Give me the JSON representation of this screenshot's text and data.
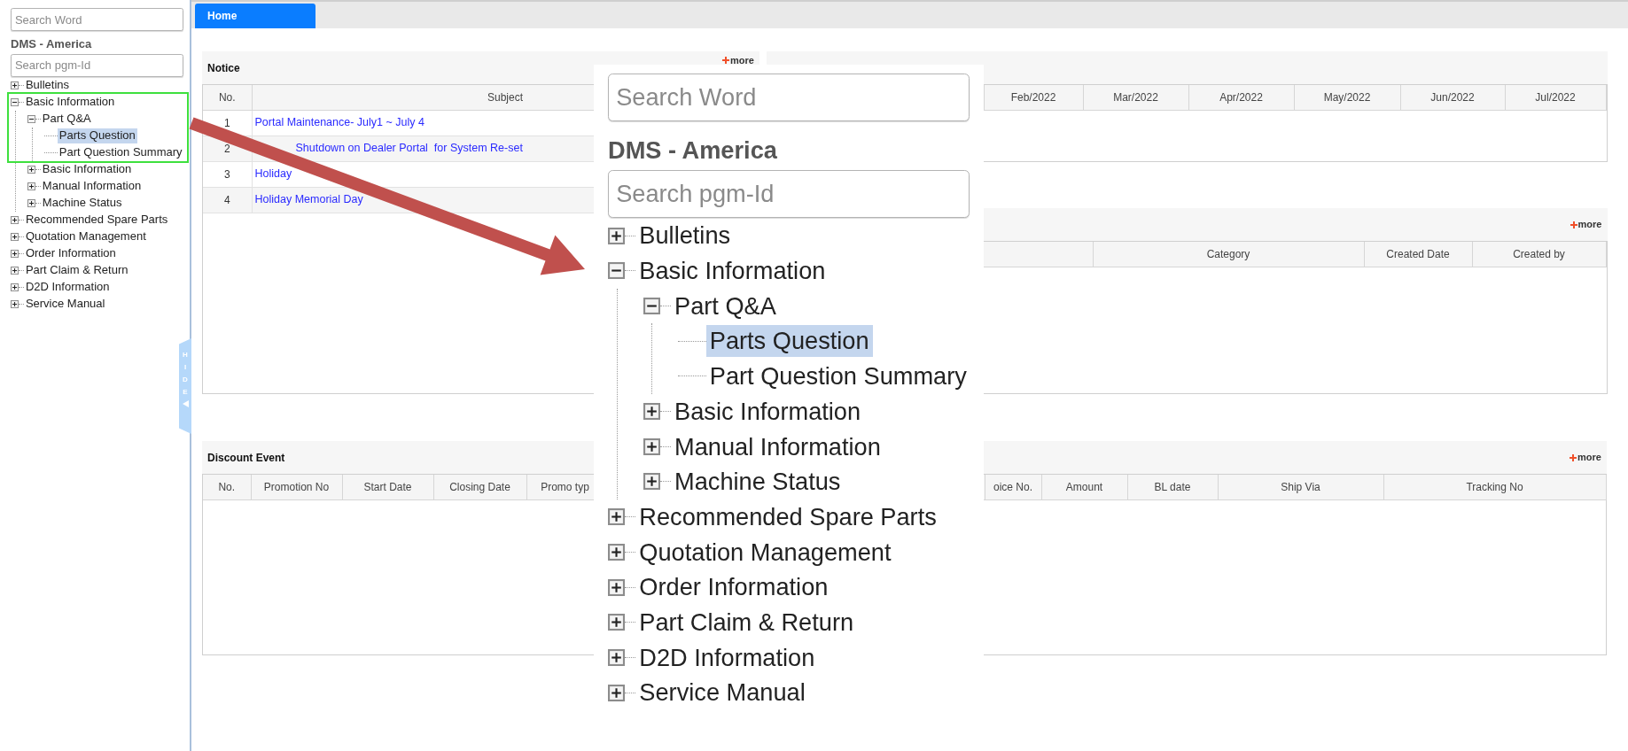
{
  "sidebar": {
    "search": {
      "placeholder": "Search Word"
    },
    "title": "DMS - America",
    "program_search": {
      "placeholder": "Search pgm-Id"
    },
    "tree": [
      {
        "label": "Bulletins",
        "expanded": false,
        "selected": false
      },
      {
        "label": "Basic Information",
        "expanded": true,
        "selected": false,
        "children": [
          {
            "label": "Part Q&A",
            "expanded": true,
            "selected": false,
            "children": [
              {
                "label": "Parts Question",
                "selected": true
              },
              {
                "label": "Part Question Summary",
                "selected": false
              }
            ]
          },
          {
            "label": "Basic Information",
            "expanded": false,
            "selected": false
          },
          {
            "label": "Manual Information",
            "expanded": false,
            "selected": false
          },
          {
            "label": "Machine Status",
            "expanded": false,
            "selected": false
          }
        ]
      },
      {
        "label": "Recommended Spare Parts",
        "expanded": false,
        "selected": false
      },
      {
        "label": "Quotation Management",
        "expanded": false,
        "selected": false
      },
      {
        "label": "Order Information",
        "expanded": false,
        "selected": false
      },
      {
        "label": "Part Claim & Return",
        "expanded": false,
        "selected": false
      },
      {
        "label": "D2D Information",
        "expanded": false,
        "selected": false
      },
      {
        "label": "Service Manual",
        "expanded": false,
        "selected": false
      }
    ],
    "hide_handle": {
      "label": "HIDE"
    }
  },
  "tabs": [
    {
      "label": "Home",
      "selected": true
    }
  ],
  "notice": {
    "title": "Notice",
    "more": "more",
    "columns": [
      "No.",
      "Subject"
    ],
    "rows": [
      {
        "no": "1",
        "subject": "Portal Maintenance- July1 ~ July 4"
      },
      {
        "no": "2",
        "subject": "Shutdown on Dealer Portal  for System Re-set"
      },
      {
        "no": "3",
        "subject": "Holiday"
      },
      {
        "no": "4",
        "subject": "Holiday Memorial Day"
      }
    ]
  },
  "order_status": {
    "columns": [
      "Feb/2022",
      "Mar/2022",
      "Apr/2022",
      "May/2022",
      "Jun/2022",
      "Jul/2022"
    ]
  },
  "board": {
    "more": "more",
    "columns": [
      "Category",
      "Created Date",
      "Created by"
    ]
  },
  "discount_event": {
    "title": "Discount Event",
    "more": "more",
    "columns": [
      "No.",
      "Promotion No",
      "Start Date",
      "Closing Date",
      "Promo typ",
      "oice No.",
      "Amount",
      "BL date",
      "Ship Via",
      "Tracking No"
    ]
  },
  "magnified_inset": {
    "search": {
      "placeholder": "Search Word"
    },
    "title": "DMS - America",
    "program_search": {
      "placeholder": "Search pgm-Id"
    },
    "tree": [
      {
        "label": "Bulletins",
        "expanded": false,
        "selected": false
      },
      {
        "label": "Basic Information",
        "expanded": true,
        "selected": false,
        "children": [
          {
            "label": "Part Q&A",
            "expanded": true,
            "selected": false,
            "children": [
              {
                "label": "Parts Question",
                "selected": true
              },
              {
                "label": "Part Question Summary",
                "selected": false
              }
            ]
          },
          {
            "label": "Basic Information",
            "expanded": false,
            "selected": false
          },
          {
            "label": "Manual Information",
            "expanded": false,
            "selected": false
          },
          {
            "label": "Machine Status",
            "expanded": false,
            "selected": false
          }
        ]
      },
      {
        "label": "Recommended Spare Parts",
        "expanded": false,
        "selected": false
      },
      {
        "label": "Quotation Management",
        "expanded": false,
        "selected": false
      },
      {
        "label": "Order Information",
        "expanded": false,
        "selected": false
      },
      {
        "label": "Part Claim & Return",
        "expanded": false,
        "selected": false
      },
      {
        "label": "D2D Information",
        "expanded": false,
        "selected": false
      },
      {
        "label": "Service Manual",
        "expanded": false,
        "selected": false
      }
    ]
  }
}
